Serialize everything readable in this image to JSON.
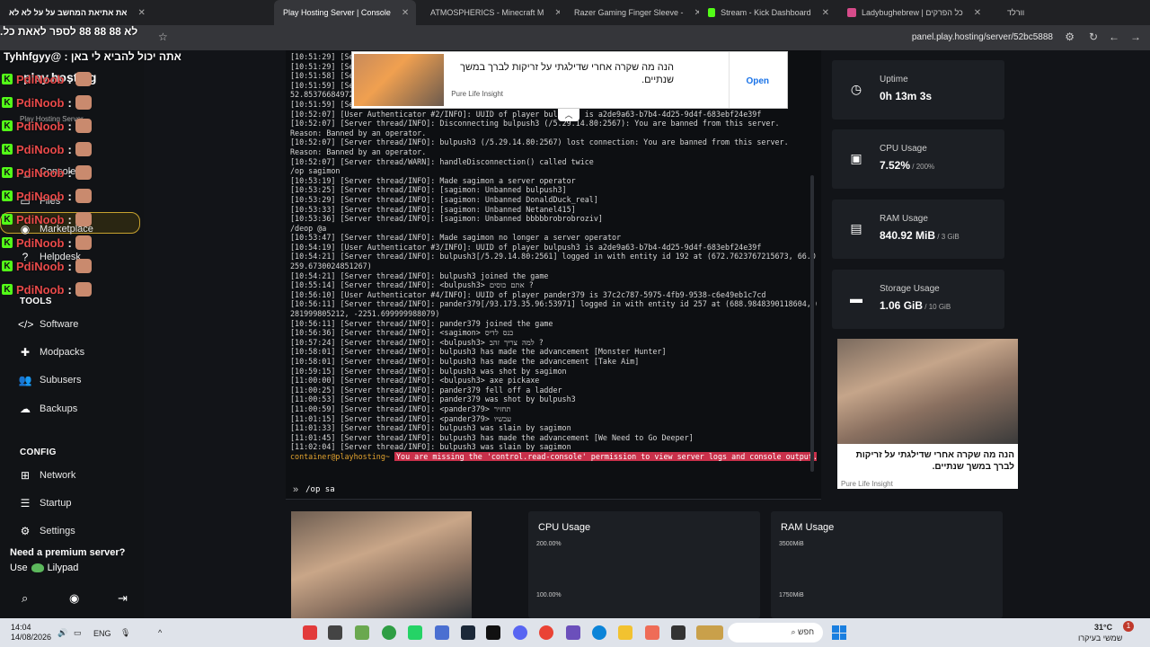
{
  "browser": {
    "tabs": [
      {
        "label": "את אתיאת המחשב על על לא לא",
        "color": "#888888"
      },
      {
        "label": "Play Hosting Server | Console",
        "color": "#e2a32f",
        "active": true
      },
      {
        "label": "ATMOSPHERICS - Minecraft M",
        "color": "#4caf50"
      },
      {
        "label": "Razer Gaming Finger Sleeve -",
        "color": "#53fc18"
      },
      {
        "label": "Stream - Kick Dashboard",
        "color": "#53fc18"
      },
      {
        "label": "Ladybughebrew | כל הפרקים",
        "color": "#d64b8a"
      },
      {
        "label": "וורלד",
        "color": "#888888"
      }
    ],
    "url": "panel.play.hosting/server/52bc5888"
  },
  "chat": {
    "top_line1": "לא 88 88 88 לספר לאאת כל.",
    "top_line2": "אתה יכול להביא לי באן : @Tyhhfgyy",
    "username": "PdiNoob",
    "line_tops": [
      80,
      106,
      132,
      158,
      184,
      210,
      236,
      262,
      288,
      314
    ]
  },
  "sidebar": {
    "brand": "play.hosting",
    "brand_sub": "Play Hosting Server",
    "items": [
      {
        "label": "Console",
        "icon": "terminal-icon"
      },
      {
        "label": "Files",
        "icon": "folder-icon"
      },
      {
        "label": "Marketplace",
        "icon": "gamepad-icon"
      },
      {
        "label": "Helpdesk",
        "icon": "help-icon"
      }
    ],
    "tools_header": "TOOLS",
    "tools": [
      {
        "label": "Software",
        "icon": "code-icon"
      },
      {
        "label": "Modpacks",
        "icon": "puzzle-icon"
      },
      {
        "label": "Subusers",
        "icon": "users-icon"
      },
      {
        "label": "Backups",
        "icon": "cloud-icon"
      }
    ],
    "config_header": "CONFIG",
    "config": [
      {
        "label": "Network",
        "icon": "network-icon"
      },
      {
        "label": "Startup",
        "icon": "sliders-icon"
      },
      {
        "label": "Settings",
        "icon": "gear-icon"
      }
    ],
    "premium_text": "Need a premium server?",
    "use_text": "Use",
    "lilypad": "Lilypad"
  },
  "console": {
    "lines": [
      "[10:51:29] [Ser",
      "[10:51:29] [Ser",
      "[10:51:58] [Ser",
      "[10:51:59] [Ser",
      "52.853766849724",
      "[10:51:59] [Ser",
      "[10:52:07] [User Authenticator #2/INFO]: UUID of player bulpush3 is a2de9a63-b7b4-4d25-9d4f-683ebf24e39f",
      "[10:52:07] [Server thread/INFO]: Disconnecting bulpush3 (/5.29.14.80:2567): You are banned from this server.",
      "Reason: Banned by an operator.",
      "[10:52:07] [Server thread/INFO]: bulpush3 (/5.29.14.80:2567) lost connection: You are banned from this server.",
      "Reason: Banned by an operator.",
      "[10:52:07] [Server thread/WARN]: handleDisconnection() called twice",
      "/op sagimon",
      "[10:53:19] [Server thread/INFO]: Made sagimon a server operator",
      "[10:53:25] [Server thread/INFO]: [sagimon: Unbanned bulpush3]",
      "[10:53:29] [Server thread/INFO]: [sagimon: Unbanned DonaldDuck_real]",
      "[10:53:33] [Server thread/INFO]: [sagimon: Unbanned Netanel415]",
      "[10:53:36] [Server thread/INFO]: [sagimon: Unbanned bbbbbrobrobroziv]",
      "/deop @a",
      "[10:53:47] [Server thread/INFO]: Made sagimon no longer a server operator",
      "[10:54:19] [User Authenticator #3/INFO]: UUID of player bulpush3 is a2de9a63-b7b4-4d25-9d4f-683ebf24e39f",
      "[10:54:21] [Server thread/INFO]: bulpush3[/5.29.14.80:2561] logged in with entity id 192 at (672.7623767215673, 66.0, -2",
      "259.6730024851267)",
      "[10:54:21] [Server thread/INFO]: bulpush3 joined the game",
      "[10:55:14] [Server thread/INFO]: <bulpush3> אתם כוסים ?",
      "[10:56:10] [User Authenticator #4/INFO]: UUID of player pander379 is 37c2c787-5975-4fb9-9538-c6e49eb1c7cd",
      "[10:56:11] [Server thread/INFO]: pander379[/93.173.35.96:53971] logged in with entity id 257 at (688.9848390118604, 67.6",
      "281999805212, -2251.699999988079)",
      "[10:56:11] [Server thread/INFO]: pander379 joined the game",
      "[10:56:36] [Server thread/INFO]: <sagimon> כנס לדיס",
      "[10:57:24] [Server thread/INFO]: <bulpush3> למה צריך זהב ?",
      "[10:58:01] [Server thread/INFO]: bulpush3 has made the advancement [Monster Hunter]",
      "[10:58:01] [Server thread/INFO]: bulpush3 has made the advancement [Take Aim]",
      "[10:59:15] [Server thread/INFO]: bulpush3 was shot by sagimon",
      "[11:00:00] [Server thread/INFO]: <bulpush3> axe pickaxe",
      "[11:00:25] [Server thread/INFO]: pander379 fell off a ladder",
      "[11:00:53] [Server thread/INFO]: pander379 was shot by bulpush3",
      "[11:00:59] [Server thread/INFO]: <pander379> תחזיר",
      "[11:01:15] [Server thread/INFO]: <pander379> עכשיו",
      "[11:01:33] [Server thread/INFO]: bulpush3 was slain by sagimon",
      "[11:01:45] [Server thread/INFO]: bulpush3 has made the advancement [We Need to Go Deeper]",
      "[11:02:04] [Server thread/INFO]: bulpush3 was slain by sagimon"
    ],
    "prompt_user": "container@playhosting~",
    "prompt_error": "You are missing the 'control.read-console' permission to view server logs and console output.",
    "input_value": "/op sa",
    "input_arrow": "»"
  },
  "ad_top": {
    "title": "הנה מה שקרה אחרי שדילגתי על זריקות לברך במשך שנתיים.",
    "source": "Pure Life Insight",
    "open_label": "Open"
  },
  "stats": [
    {
      "label": "Uptime",
      "value": "0h 13m 3s",
      "sub": "",
      "icon": "clock-icon"
    },
    {
      "label": "CPU Usage",
      "value": "7.52%",
      "sub": " / 200%",
      "icon": "cpu-icon"
    },
    {
      "label": "RAM Usage",
      "value": "840.92 MiB",
      "sub": " / 3 GiB",
      "icon": "memory-icon"
    },
    {
      "label": "Storage Usage",
      "value": "1.06 GiB",
      "sub": " / 10 GiB",
      "icon": "storage-icon"
    }
  ],
  "ad_right": {
    "title": "הנה מה שקרה אחרי שדילגתי על זריקות לברך במשך שנתיים.",
    "source": "Pure Life Insight"
  },
  "charts": {
    "cpu": {
      "title": "CPU Usage",
      "tick_top": "200.00%",
      "tick_mid": "100.00%"
    },
    "ram": {
      "title": "RAM Usage",
      "tick_top": "3500MiB",
      "tick_mid": "1750MiB"
    }
  },
  "taskbar": {
    "time": "14:04",
    "date": "14/08/2026",
    "lang": "ENG",
    "search_placeholder": "חפש",
    "weather_temp": "31°C",
    "weather_desc": "שמשי בעיקרו",
    "notif_count": "1"
  }
}
